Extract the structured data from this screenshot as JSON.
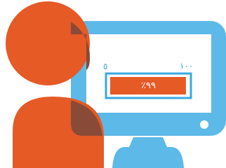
{
  "illustration": {
    "monitor": {
      "color": "#5db9e8",
      "dark_color": "#3a8fc7"
    },
    "person": {
      "color": "#e55a25",
      "overlap_color": "#8a4a38"
    },
    "progress": {
      "min_label": "٥",
      "max_label": "١٠٠",
      "value_label": "٪٩٩",
      "value": 99,
      "fill_color": "#e55a25",
      "frame_color": "#3aa8e0"
    }
  }
}
